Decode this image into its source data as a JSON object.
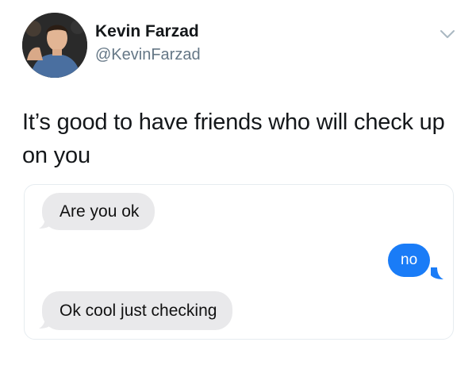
{
  "tweet": {
    "author": {
      "display_name": "Kevin Farzad",
      "handle": "@KevinFarzad"
    },
    "text": "It’s good to have friends who will check up on you",
    "more_icon": "chevron-down-icon"
  },
  "embedded_chat": {
    "messages": [
      {
        "text": "Are you ok",
        "side": "received"
      },
      {
        "text": "no",
        "side": "sent"
      },
      {
        "text": "Ok cool just checking",
        "side": "received"
      }
    ],
    "colors": {
      "received_bubble": "#e9e9eb",
      "sent_bubble": "#1a7cf7"
    }
  }
}
